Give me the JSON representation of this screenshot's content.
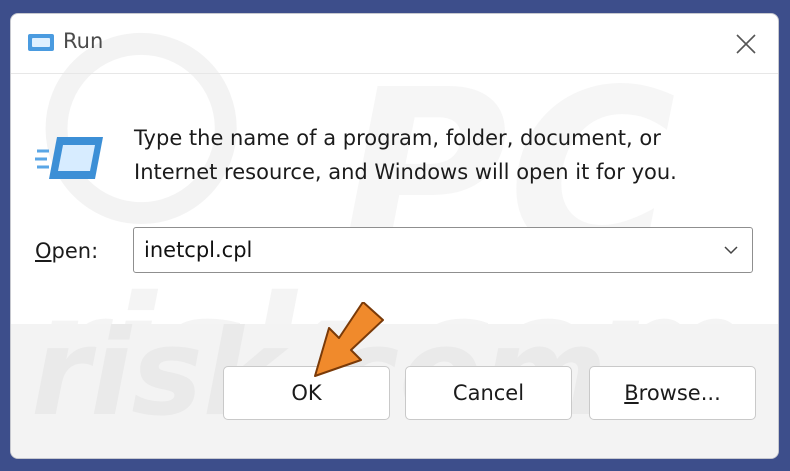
{
  "window": {
    "title": "Run"
  },
  "description": {
    "line1": "Type the name of a program, folder, document, or",
    "line2": "Internet resource, and Windows will open it for you."
  },
  "open_field": {
    "label_mnemonic": "O",
    "label_rest": "pen:",
    "value": "inetcpl.cpl"
  },
  "buttons": {
    "ok": "OK",
    "cancel": "Cancel",
    "browse_mnemonic": "B",
    "browse_rest": "rowse..."
  },
  "colors": {
    "accent_arrow": "#f08a2c",
    "icon_blue": "#3c8fd6",
    "footer_bg": "#f3f3f3"
  },
  "icons": {
    "title": "run-icon",
    "close": "close-icon",
    "dropdown": "chevron-down-icon",
    "annotation": "orange-arrow-icon"
  }
}
